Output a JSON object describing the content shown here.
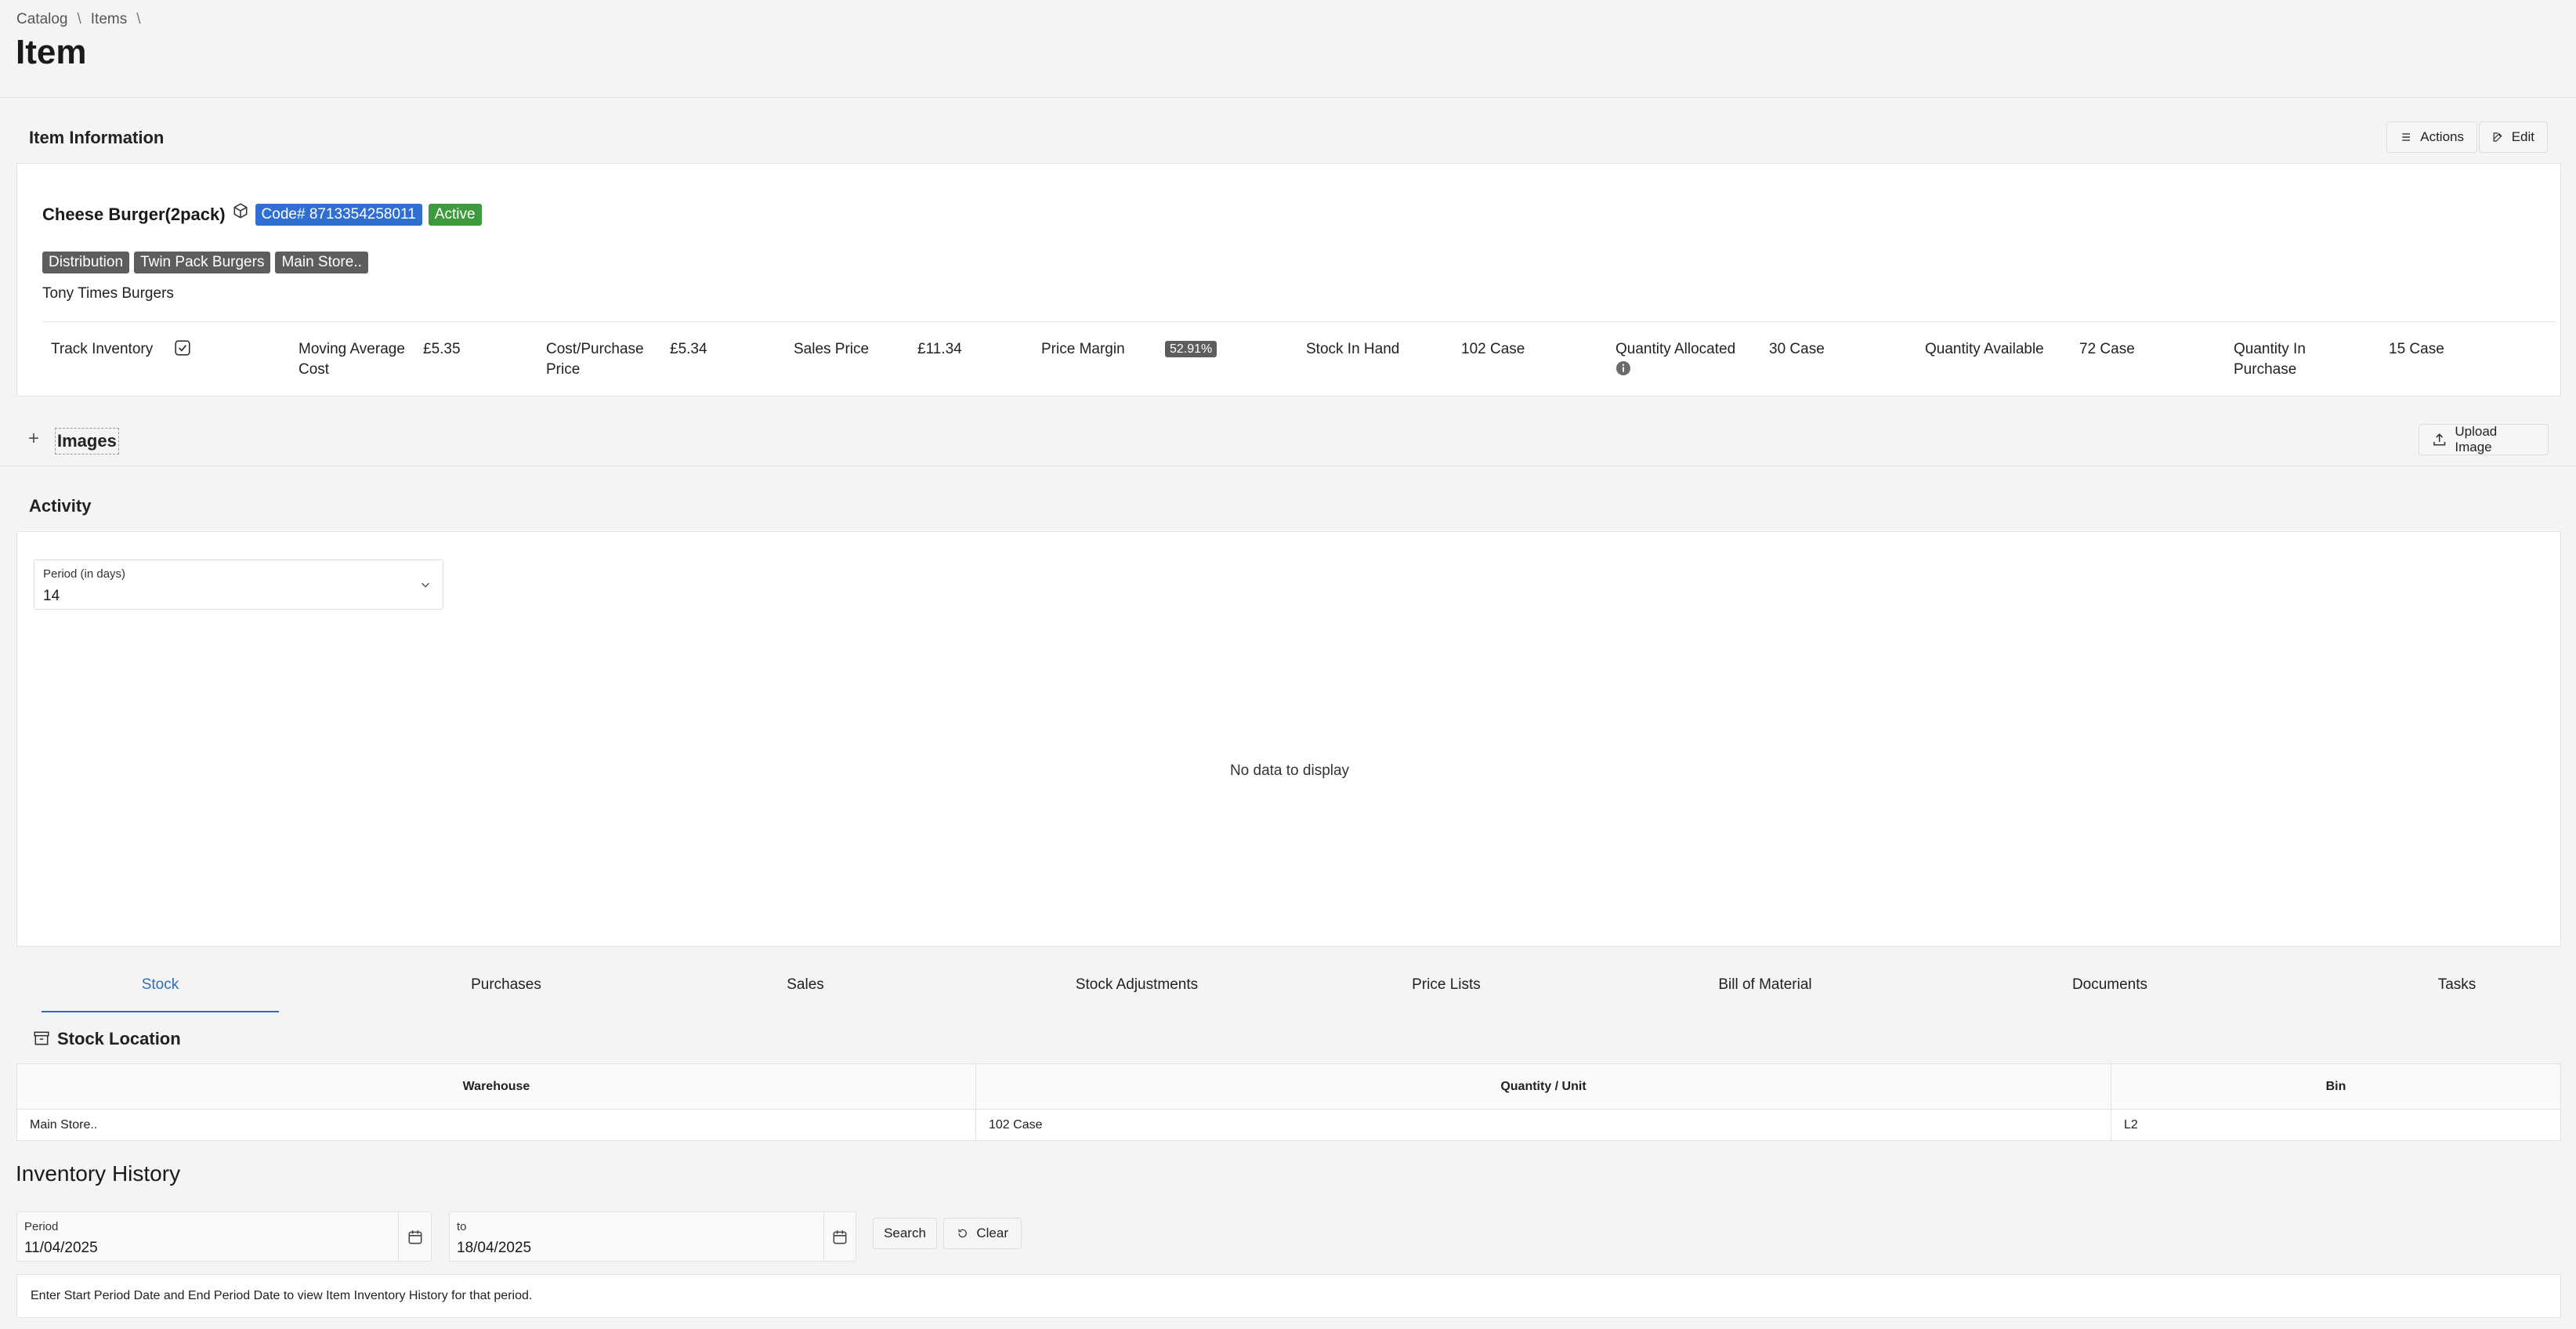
{
  "breadcrumb": {
    "items": [
      "Catalog",
      "Items"
    ],
    "separator": "\\"
  },
  "page": {
    "title": "Item"
  },
  "item_info": {
    "section_title": "Item Information",
    "actions_label": "Actions",
    "edit_label": "Edit",
    "name": "Cheese Burger(2pack)",
    "code": "Code# 8713354258011",
    "status": "Active",
    "tags": [
      "Distribution",
      "Twin Pack Burgers",
      "Main Store.."
    ],
    "supplier": "Tony Times Burgers",
    "stats": {
      "track_inventory_label": "Track Inventory",
      "moving_avg_label": "Moving Average Cost",
      "moving_avg_value": "£5.35",
      "cost_label": "Cost/Purchase Price",
      "cost_value": "£5.34",
      "sales_label": "Sales Price",
      "sales_value": "£11.34",
      "margin_label": "Price Margin",
      "margin_value": "52.91%",
      "stock_label": "Stock In Hand",
      "stock_value": "102 Case",
      "allocated_label": "Quantity Allocated",
      "allocated_value": "30 Case",
      "available_label": "Quantity Available",
      "available_value": "72 Case",
      "in_purchase_label": "Quantity In Purchase",
      "in_purchase_value": "15 Case"
    }
  },
  "images": {
    "title": "Images",
    "upload_label": "Upload Image"
  },
  "activity": {
    "title": "Activity",
    "period_label": "Period (in days)",
    "period_value": "14",
    "empty_text": "No data to display"
  },
  "tabs": [
    "Stock",
    "Purchases",
    "Sales",
    "Stock Adjustments",
    "Price Lists",
    "Bill of Material",
    "Documents",
    "Tasks"
  ],
  "stock_location": {
    "title": "Stock Location",
    "columns": [
      "Warehouse",
      "Quantity / Unit",
      "Bin"
    ],
    "rows": [
      [
        "Main Store..",
        "102 Case",
        "L2"
      ]
    ]
  },
  "inventory_history": {
    "title": "Inventory History",
    "period_label": "Period",
    "start_date": "11/04/2025",
    "to_label": "to",
    "end_date": "18/04/2025",
    "search_label": "Search",
    "clear_label": "Clear",
    "hint": "Enter Start Period Date and End Period Date to view Item Inventory History for that period."
  }
}
